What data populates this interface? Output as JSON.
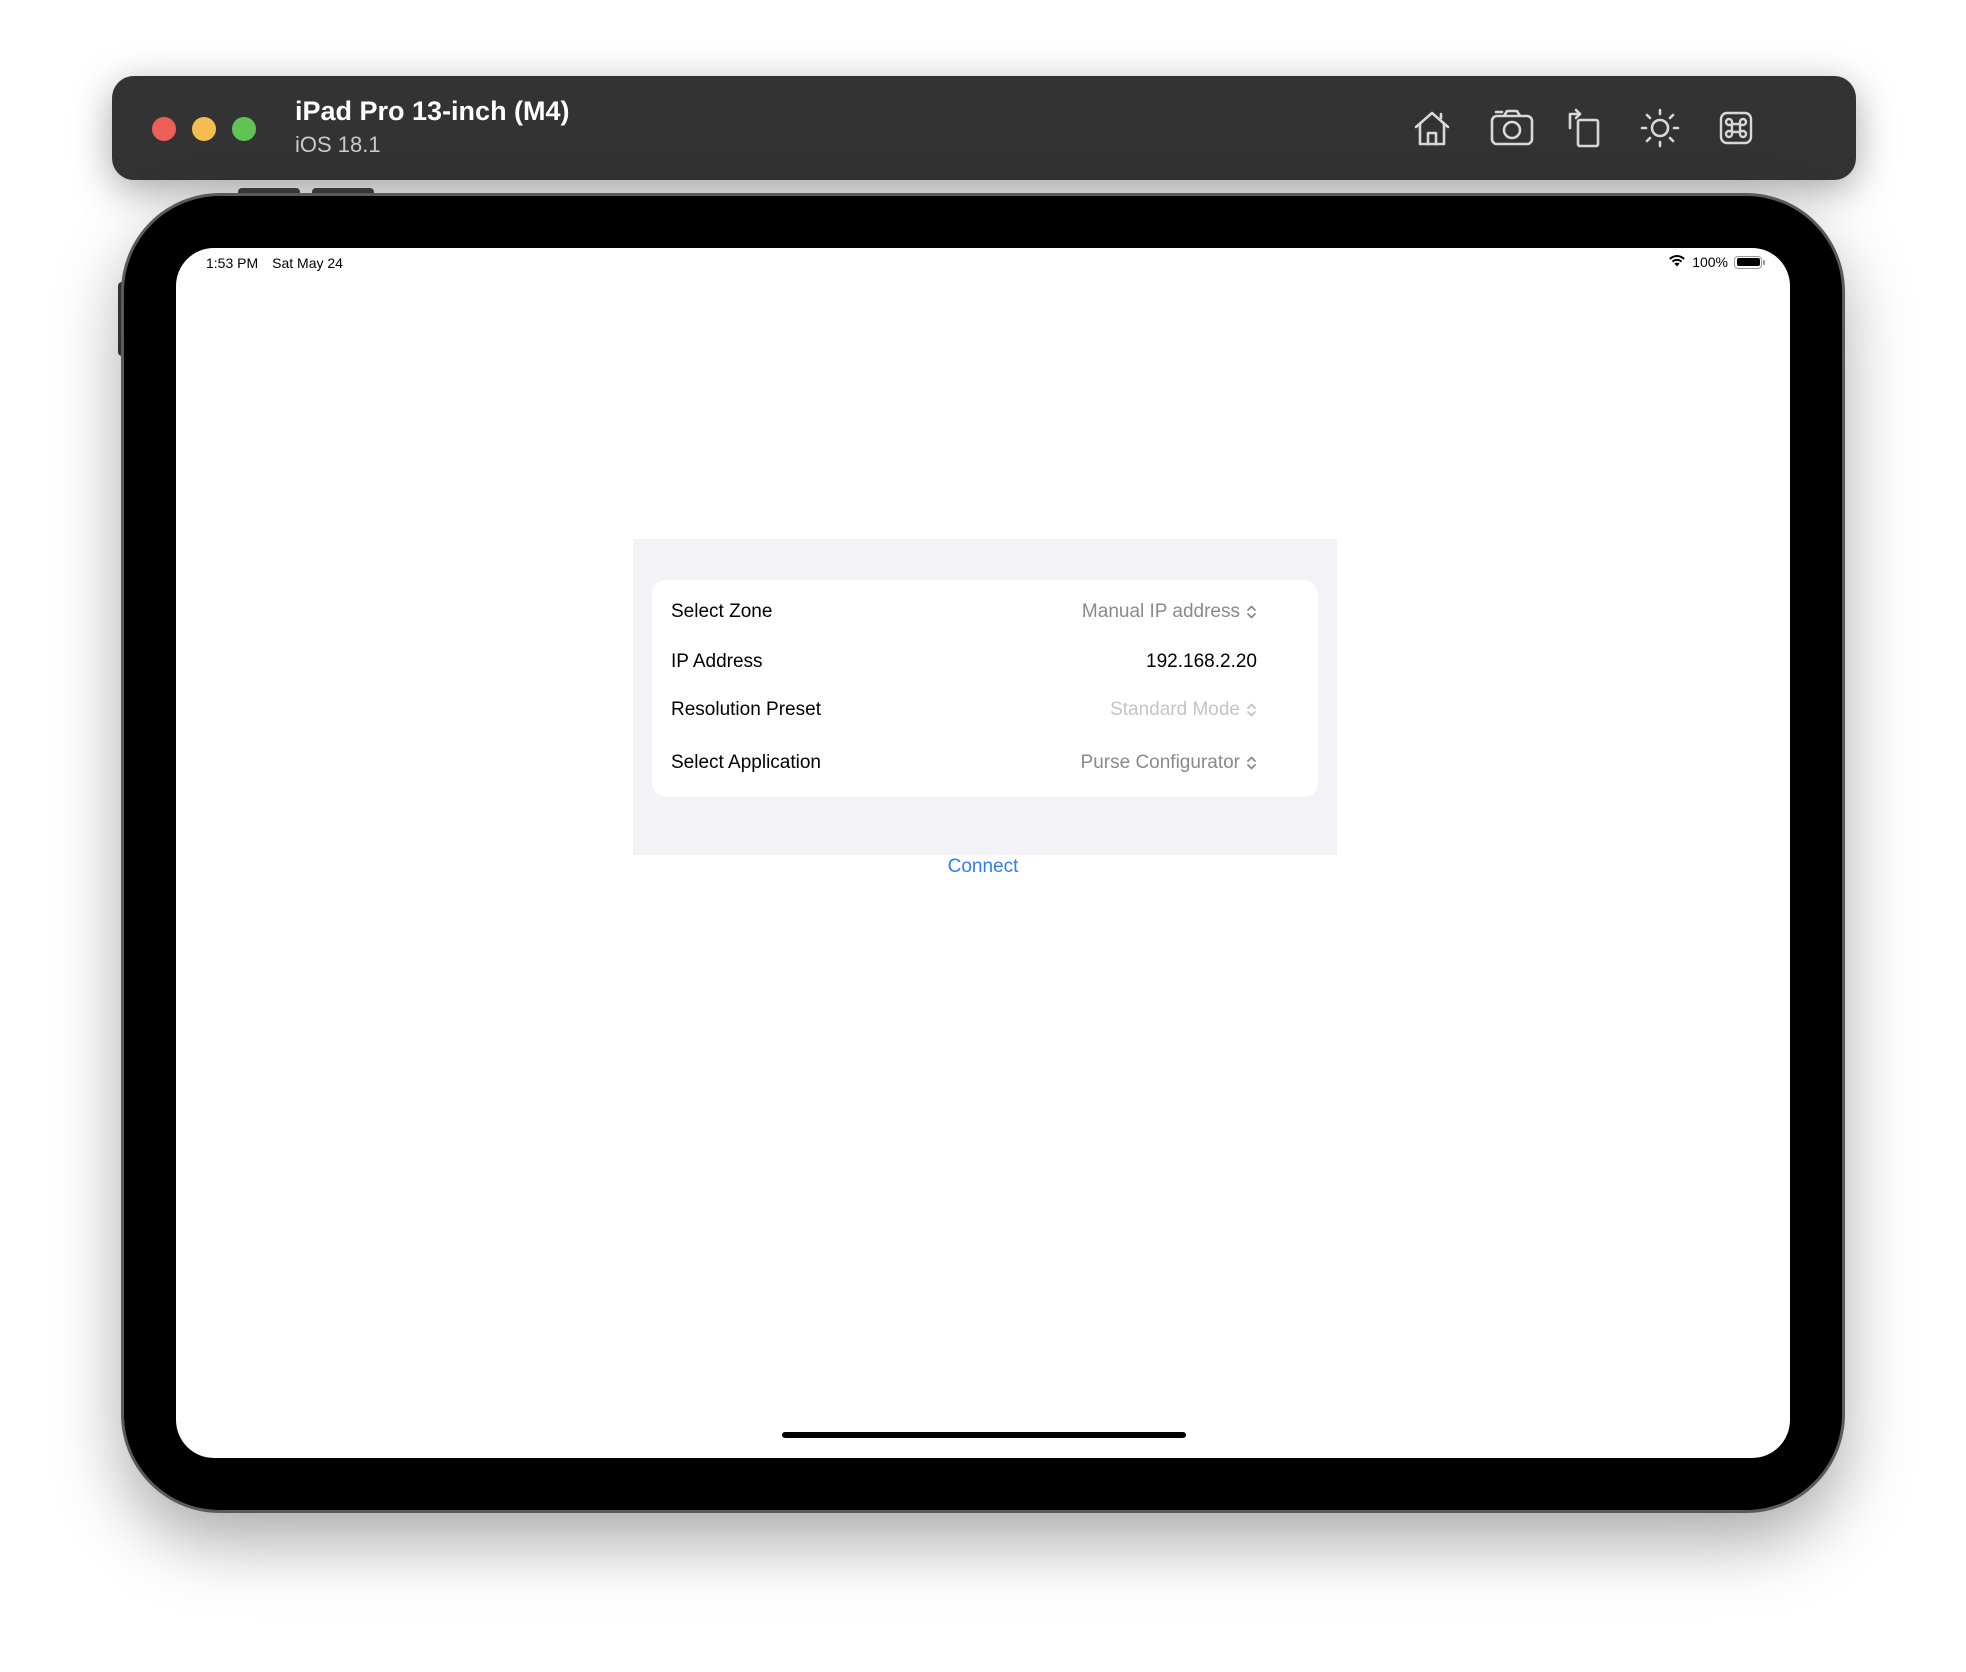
{
  "window": {
    "device_name": "iPad Pro 13-inch (M4)",
    "os_version": "iOS 18.1",
    "toolbar_icons": [
      "home-icon",
      "screenshot-icon",
      "rotate-icon",
      "appearance-icon",
      "command-icon"
    ]
  },
  "status_bar": {
    "time": "1:53 PM",
    "date": "Sat May 24",
    "battery": "100%"
  },
  "form": {
    "rows": [
      {
        "label": "Select Zone",
        "value": "Manual IP address"
      },
      {
        "label": "IP Address",
        "value": "192.168.2.20"
      },
      {
        "label": "Resolution Preset",
        "value": "Standard Mode"
      },
      {
        "label": "Select Application",
        "value": "Purse Configurator"
      }
    ],
    "connect_label": "Connect"
  },
  "colors": {
    "accent": "#2f7cf6",
    "titlebar": "#333333",
    "grouped_background": "#f2f2f7"
  }
}
